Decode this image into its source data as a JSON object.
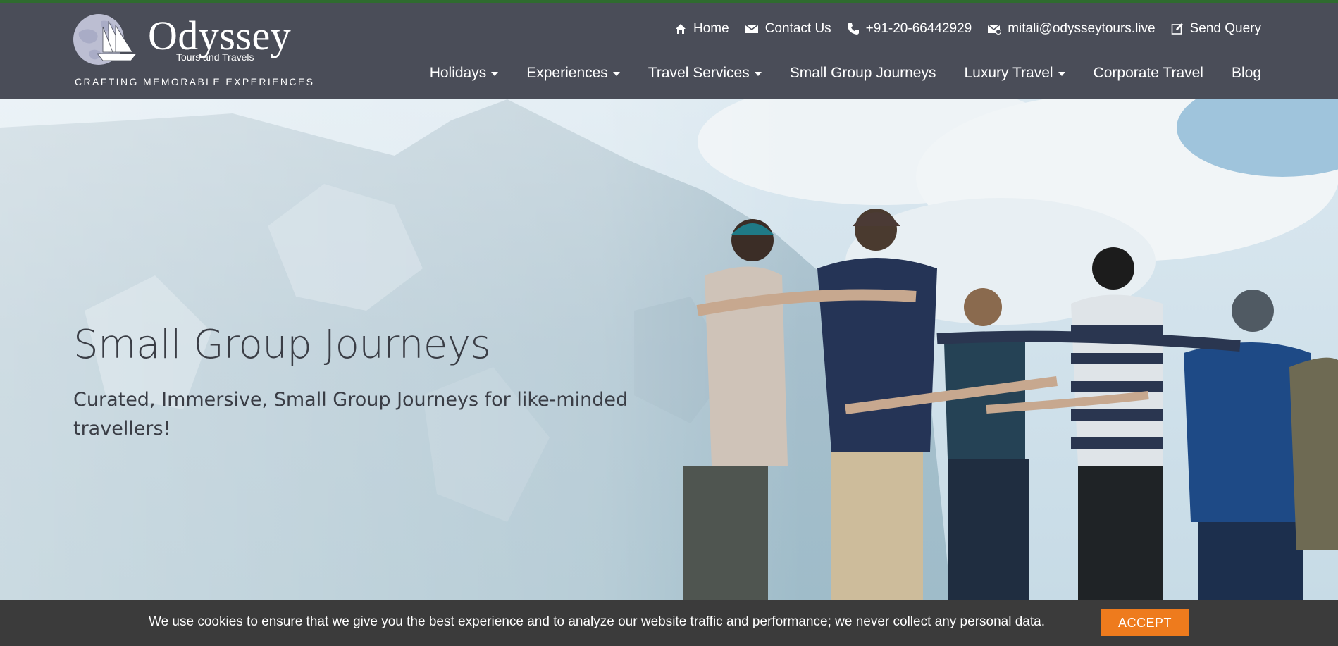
{
  "brand": {
    "name": "Odyssey",
    "sub": "Tours and Travels",
    "tagline": "CRAFTING MEMORABLE EXPERIENCES"
  },
  "util_nav": [
    {
      "label": "Home",
      "icon": "home-icon"
    },
    {
      "label": "Contact Us",
      "icon": "envelope-icon"
    },
    {
      "label": "+91-20-66442929",
      "icon": "phone-icon"
    },
    {
      "label": "mitali@odysseytours.live",
      "icon": "email-icon"
    },
    {
      "label": "Send Query",
      "icon": "edit-icon"
    }
  ],
  "main_nav": [
    {
      "label": "Holidays",
      "dropdown": true
    },
    {
      "label": "Experiences",
      "dropdown": true
    },
    {
      "label": "Travel Services",
      "dropdown": true
    },
    {
      "label": "Small Group Journeys",
      "dropdown": false
    },
    {
      "label": "Luxury Travel",
      "dropdown": true
    },
    {
      "label": "Corporate Travel",
      "dropdown": false
    },
    {
      "label": "Blog",
      "dropdown": false
    }
  ],
  "hero": {
    "title": "Small Group Journeys",
    "subtitle": "Curated, Immersive, Small Group Journeys for like-minded travellers!"
  },
  "cookie": {
    "text": "We use cookies to ensure that we give you the best experience and to analyze our website traffic and performance; we never collect any personal data.",
    "accept_label": "ACCEPT"
  },
  "colors": {
    "header_bg": "#4a4d58",
    "top_strip": "#2f6b2f",
    "accept": "#ee7b1d",
    "cookie_bg": "#3b3b3b"
  }
}
